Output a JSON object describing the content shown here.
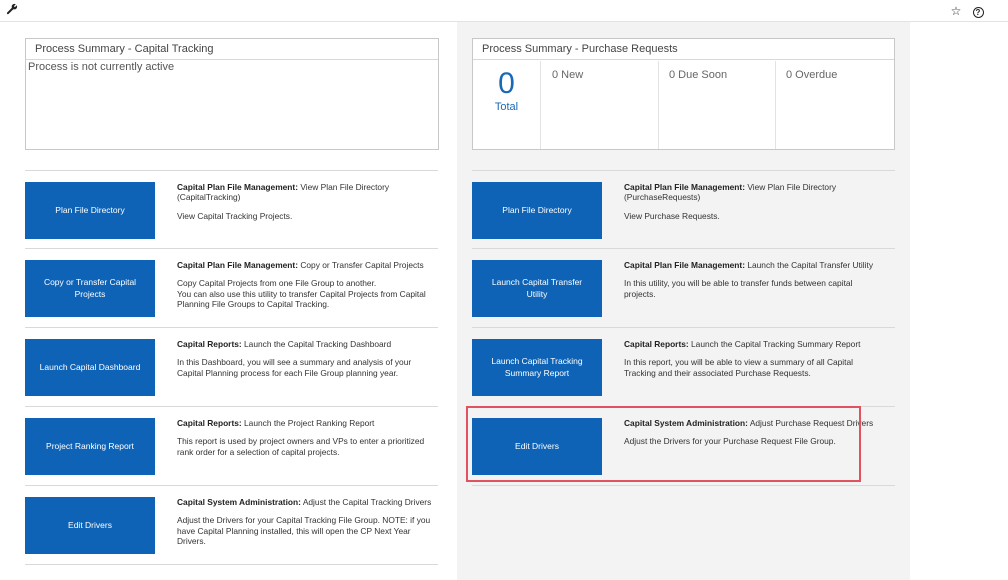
{
  "toolbar": {
    "wrench_icon": "wrench-icon",
    "star_icon": "star-icon",
    "help_icon": "help-icon"
  },
  "capital_summary": {
    "title": "Process Summary - Capital Tracking",
    "message": "Process is not currently active"
  },
  "purchase_summary": {
    "title": "Process Summary - Purchase Requests",
    "total_value": "0",
    "total_label": "Total",
    "new": "0 New",
    "due_soon": "0 Due Soon",
    "overdue": "0 Overdue"
  },
  "left_items": [
    {
      "button": "Plan File Directory",
      "title_bold": "Capital Plan File Management:",
      "title_rest": " View Plan File Directory (CapitalTracking)",
      "body": "View Capital Tracking Projects."
    },
    {
      "button": "Copy or Transfer Capital Projects",
      "title_bold": "Capital Plan File Management:",
      "title_rest": " Copy or Transfer Capital Projects",
      "body": "Copy Capital Projects from one File Group to another.\nYou can also use this utility to transfer Capital Projects from Capital Planning File Groups to Capital Tracking."
    },
    {
      "button": "Launch Capital Dashboard",
      "title_bold": "Capital Reports:",
      "title_rest": " Launch the Capital Tracking Dashboard",
      "body": "In this Dashboard, you will see a summary and analysis of your Capital Planning process for each File Group planning year."
    },
    {
      "button": "Project Ranking Report",
      "title_bold": "Capital Reports:",
      "title_rest": " Launch the Project Ranking Report",
      "body": "This report is used by project owners and VPs to enter a prioritized rank order for a selection of capital projects."
    },
    {
      "button": "Edit Drivers",
      "title_bold": "Capital System Administration:",
      "title_rest": " Adjust the Capital Tracking Drivers",
      "body": "Adjust the Drivers for your Capital Tracking File Group. NOTE: if you have Capital Planning installed, this will open the CP Next Year Drivers."
    }
  ],
  "right_items": [
    {
      "button": "Plan File Directory",
      "title_bold": "Capital Plan File Management:",
      "title_rest": " View Plan File Directory (PurchaseRequests)",
      "body": "View Purchase Requests."
    },
    {
      "button": "Launch Capital Transfer Utility",
      "title_bold": "Capital Plan File Management:",
      "title_rest": " Launch the Capital Transfer Utility",
      "body": "In this utility, you will be able to transfer funds between capital projects."
    },
    {
      "button": "Launch Capital Tracking Summary Report",
      "title_bold": "Capital Reports:",
      "title_rest": " Launch the Capital Tracking Summary Report",
      "body": "In this report, you will be able to view a summary of all Capital Tracking and their associated Purchase Requests."
    },
    {
      "button": "Edit Drivers",
      "title_bold": "Capital System Administration:",
      "title_rest": " Adjust Purchase Request Drivers",
      "body": "Adjust the Drivers for your Purchase Request File Group."
    }
  ],
  "colors": {
    "tile_blue": "#0e63b6",
    "highlight_red": "#e05260",
    "kpi_blue": "#1b68b5"
  }
}
